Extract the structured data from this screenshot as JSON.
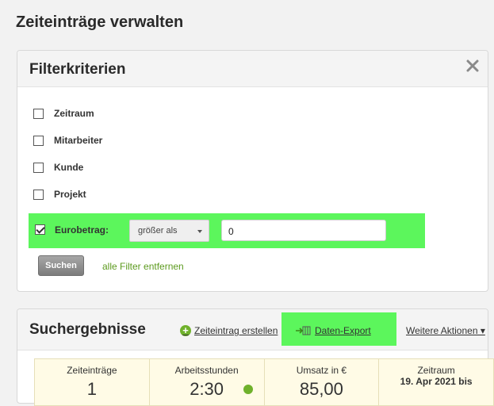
{
  "page": {
    "title": "Zeiteinträge verwalten"
  },
  "filter": {
    "title": "Filterkriterien",
    "items": [
      {
        "label": "Zeitraum",
        "checked": false
      },
      {
        "label": "Mitarbeiter",
        "checked": false
      },
      {
        "label": "Kunde",
        "checked": false
      },
      {
        "label": "Projekt",
        "checked": false
      }
    ],
    "euro": {
      "label": "Eurobetrag:",
      "checked": true,
      "operator": "größer als",
      "value": "0"
    },
    "search_label": "Suchen",
    "remove_label": "alle Filter entfernen",
    "highlight_color": "#5cf65c"
  },
  "results": {
    "title": "Suchergebnisse",
    "create_label": "Zeiteintrag erstellen",
    "export_label": "Daten-Export",
    "more_label": "Weitere Aktionen ▾",
    "stats": [
      {
        "label": "Zeiteinträge",
        "value": "1"
      },
      {
        "label": "Arbeitsstunden",
        "value": "2:30"
      },
      {
        "label": "Umsatz in €",
        "value": "85,00"
      },
      {
        "label": "Zeitraum",
        "value": "19. Apr 2021 bis"
      }
    ]
  },
  "icons": {
    "close": "close-icon",
    "plus": "plus-circle-icon",
    "export": "export-icon",
    "dropdown": "chevron-down-icon"
  }
}
